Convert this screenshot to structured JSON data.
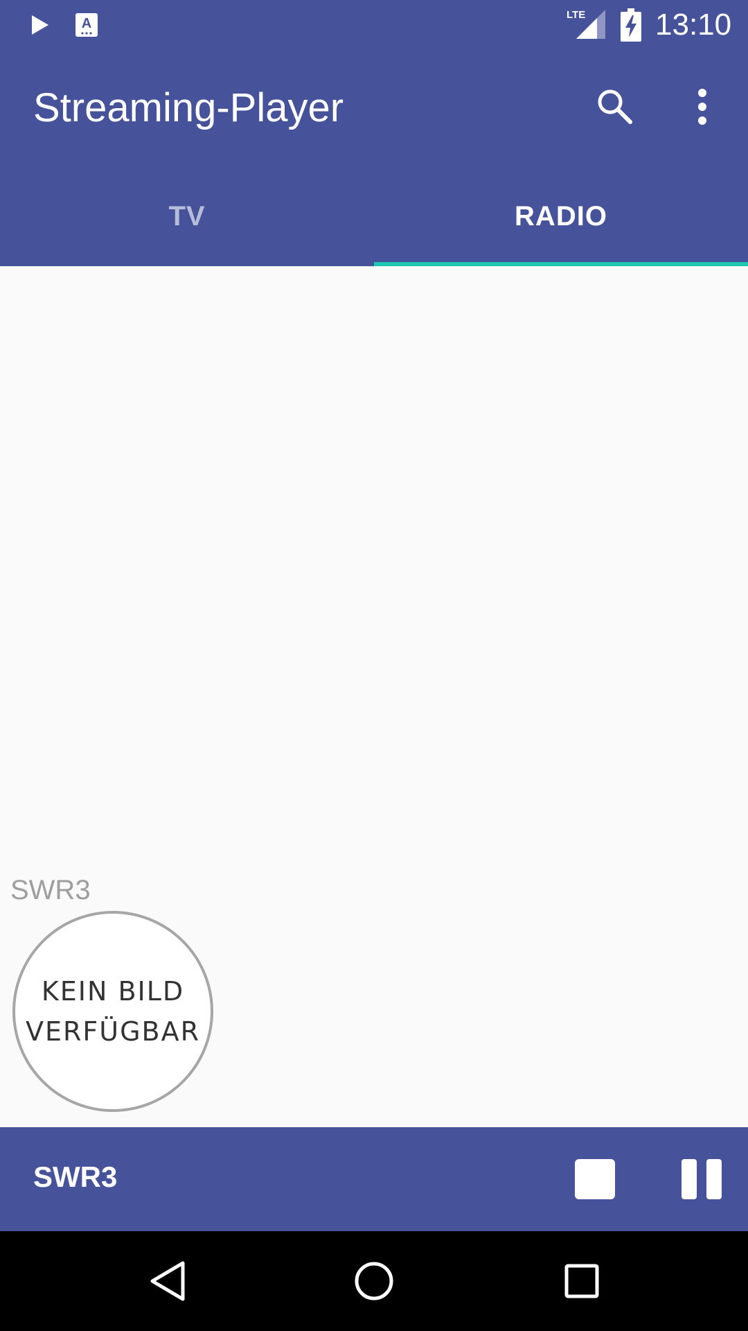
{
  "status_bar": {
    "time": "13:10",
    "network_label": "LTE",
    "icons": [
      "play-icon",
      "a-icon",
      "lte-signal-icon",
      "battery-charging-icon"
    ]
  },
  "app_bar": {
    "title": "Streaming-Player",
    "actions": [
      "search-icon",
      "more-vert-icon"
    ]
  },
  "tabs": [
    {
      "label": "TV",
      "selected": false
    },
    {
      "label": "RADIO",
      "selected": true
    }
  ],
  "content": {
    "station_name": "SWR3",
    "logo_placeholder_line1": "KEIN BILD",
    "logo_placeholder_line2": "VERFÜGBAR"
  },
  "player": {
    "title": "SWR3",
    "controls": [
      "stop-icon",
      "pause-icon"
    ]
  },
  "colors": {
    "primary": "#46539a",
    "accent": "#1ec8b0",
    "background": "#fafafa"
  }
}
